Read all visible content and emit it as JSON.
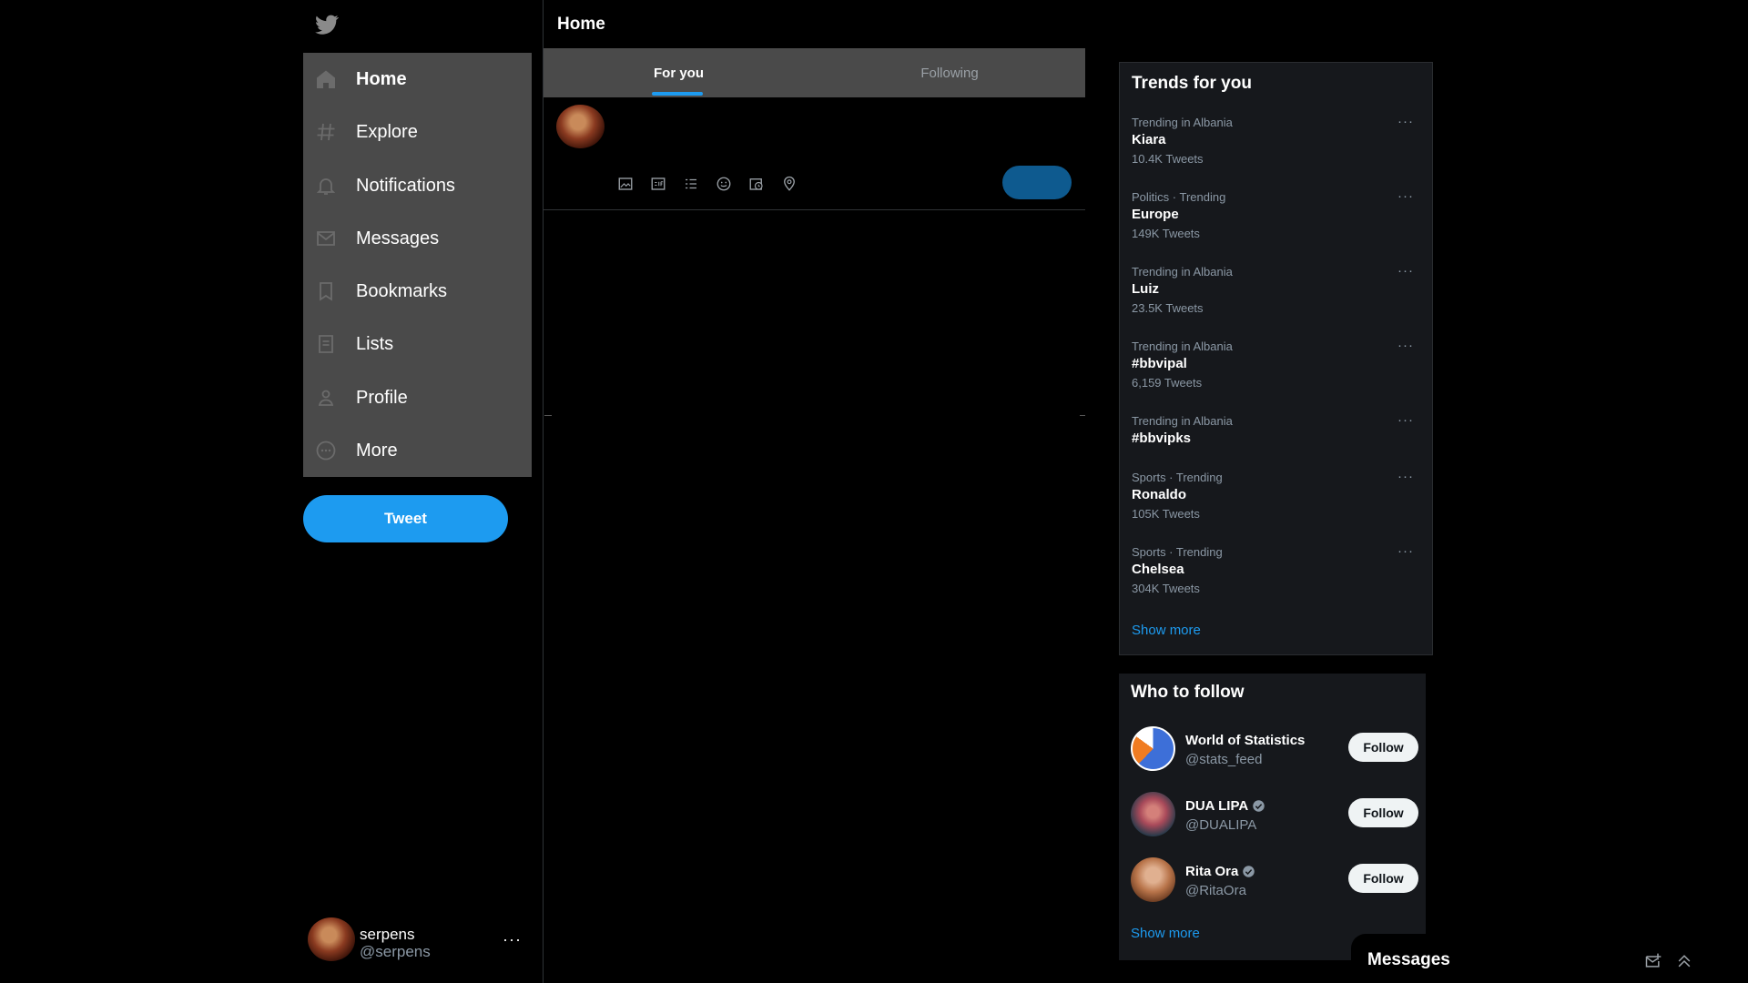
{
  "nav": {
    "items": [
      {
        "label": "Home",
        "icon": "home-icon"
      },
      {
        "label": "Explore",
        "icon": "hashtag-icon"
      },
      {
        "label": "Notifications",
        "icon": "bell-icon"
      },
      {
        "label": "Messages",
        "icon": "envelope-icon"
      },
      {
        "label": "Bookmarks",
        "icon": "bookmark-icon"
      },
      {
        "label": "Lists",
        "icon": "list-icon"
      },
      {
        "label": "Profile",
        "icon": "person-icon"
      },
      {
        "label": "More",
        "icon": "more-circle-icon"
      }
    ],
    "tweet_label": "Tweet"
  },
  "account": {
    "name": "serpens",
    "handle": "@serpens",
    "more": "···"
  },
  "main": {
    "title": "Home",
    "tabs": [
      {
        "label": "For you"
      },
      {
        "label": "Following"
      }
    ]
  },
  "trends": {
    "title": "Trends for you",
    "items": [
      {
        "context": "Trending in Albania",
        "topic": "Kiara",
        "count": "10.4K Tweets"
      },
      {
        "context": "Politics · Trending",
        "topic": "Europe",
        "count": "149K Tweets"
      },
      {
        "context": "Trending in Albania",
        "topic": "Luiz",
        "count": "23.5K Tweets"
      },
      {
        "context": "Trending in Albania",
        "topic": "#bbvipal",
        "count": "6,159 Tweets"
      },
      {
        "context": "Trending in Albania",
        "topic": "#bbvipks",
        "count": ""
      },
      {
        "context": "Sports · Trending",
        "topic": "Ronaldo",
        "count": "105K Tweets"
      },
      {
        "context": "Sports · Trending",
        "topic": "Chelsea",
        "count": "304K Tweets"
      }
    ],
    "more_dots": "···",
    "show_more": "Show more"
  },
  "who_to_follow": {
    "title": "Who to follow",
    "accounts": [
      {
        "name": "World of Statistics",
        "handle": "@stats_feed",
        "verified": false
      },
      {
        "name": "DUA LIPA",
        "handle": "@DUALIPA",
        "verified": true
      },
      {
        "name": "Rita Ora",
        "handle": "@RitaOra",
        "verified": true
      }
    ],
    "follow_label": "Follow",
    "show_more": "Show more"
  },
  "messages_drawer": {
    "title": "Messages"
  },
  "colors": {
    "accent": "#1d9bf0",
    "nav_bg": "#4a4a4a",
    "panel_bg": "#16181c",
    "muted": "#8b98a5"
  }
}
